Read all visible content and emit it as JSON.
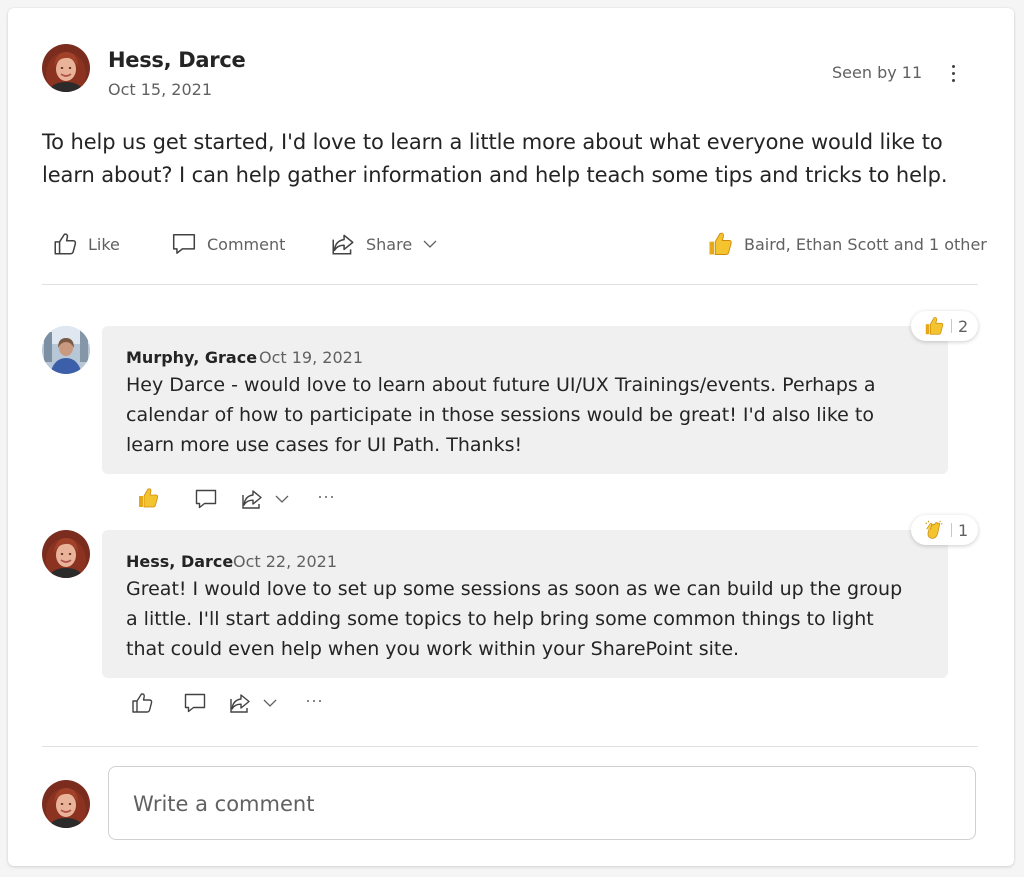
{
  "post": {
    "author": "Hess, Darce",
    "date": "Oct 15, 2021",
    "seen_by": "Seen by 11",
    "body": "To help us get started, I'd love to learn a little more about what everyone would like to learn about? I can help gather information and help teach some tips and tricks to help.",
    "actions": {
      "like": "Like",
      "comment": "Comment",
      "share": "Share"
    },
    "reactors": "Baird, Ethan Scott and 1 other"
  },
  "comments": [
    {
      "author": "Murphy, Grace",
      "date": "Oct 19, 2021",
      "text": "Hey Darce - would love to learn about future UI/UX Trainings/events. Perhaps a calendar of how to participate in those sessions would be great! I'd also like to learn more use cases for UI Path. Thanks!",
      "reaction": {
        "icon": "thumbs-up-icon",
        "count": "2"
      }
    },
    {
      "author": "Hess, Darce",
      "date": "Oct 22, 2021",
      "text": "Great! I would love to set up some sessions as soon as we can build up the group a little. I'll start adding some topics to help bring some common things to light that could even help when you work within your SharePoint site.",
      "reaction": {
        "icon": "clapping-hands-icon",
        "count": "1"
      }
    }
  ],
  "composer": {
    "placeholder": "Write a comment"
  },
  "colors": {
    "reaction_yellow": "#f4c430",
    "text_primary": "#242424",
    "text_secondary": "#616161",
    "bubble_bg": "#f0f0f0"
  }
}
